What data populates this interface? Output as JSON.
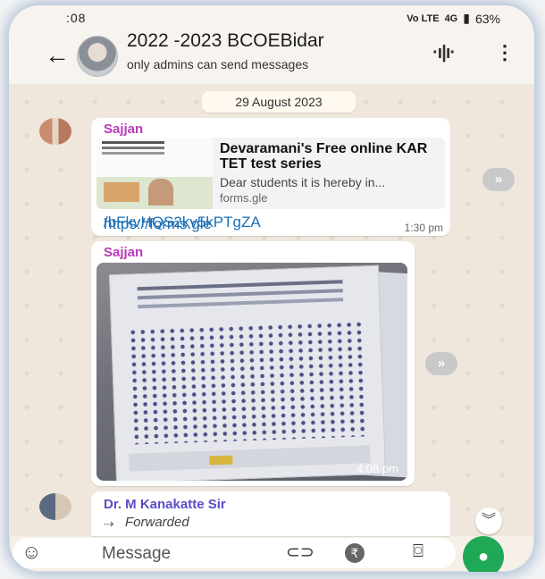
{
  "status_bar": {
    "time": ":08",
    "signal_label": "Vo LTE",
    "network": "4G",
    "battery": "63%"
  },
  "header": {
    "title": "2022 -2023 BCOEBidar",
    "subtitle": "only admins can send messages"
  },
  "chat": {
    "date_chip": "29 August 2023",
    "messages": [
      {
        "sender": "Sajjan",
        "link_preview": {
          "title": "Devaramani's Free online KAR TET test series",
          "description": "Dear students it is hereby in...",
          "host": "forms.gle"
        },
        "link_line1": "https://forms.gle",
        "link_line2": "/bFkvHQS2kv5kPTgZA",
        "time": "1:30 pm"
      },
      {
        "sender": "Sajjan",
        "attachment": "photo",
        "time": "4:08 pm"
      },
      {
        "sender": "Dr. M Kanakatte Sir",
        "forwarded_label": "Forwarded"
      }
    ]
  },
  "input": {
    "placeholder": "Message"
  },
  "icons": [
    "back-arrow-icon",
    "audio-wave-icon",
    "more-vert-icon",
    "forward-icon",
    "chevron-down-icon",
    "emoji-icon",
    "attach-icon",
    "rupee-icon",
    "camera-icon",
    "mic-icon"
  ],
  "colors": {
    "sender": "#b83bb8",
    "link": "#1a6fb5",
    "mic": "#1fa855",
    "chat_bg": "#efe7dc"
  }
}
